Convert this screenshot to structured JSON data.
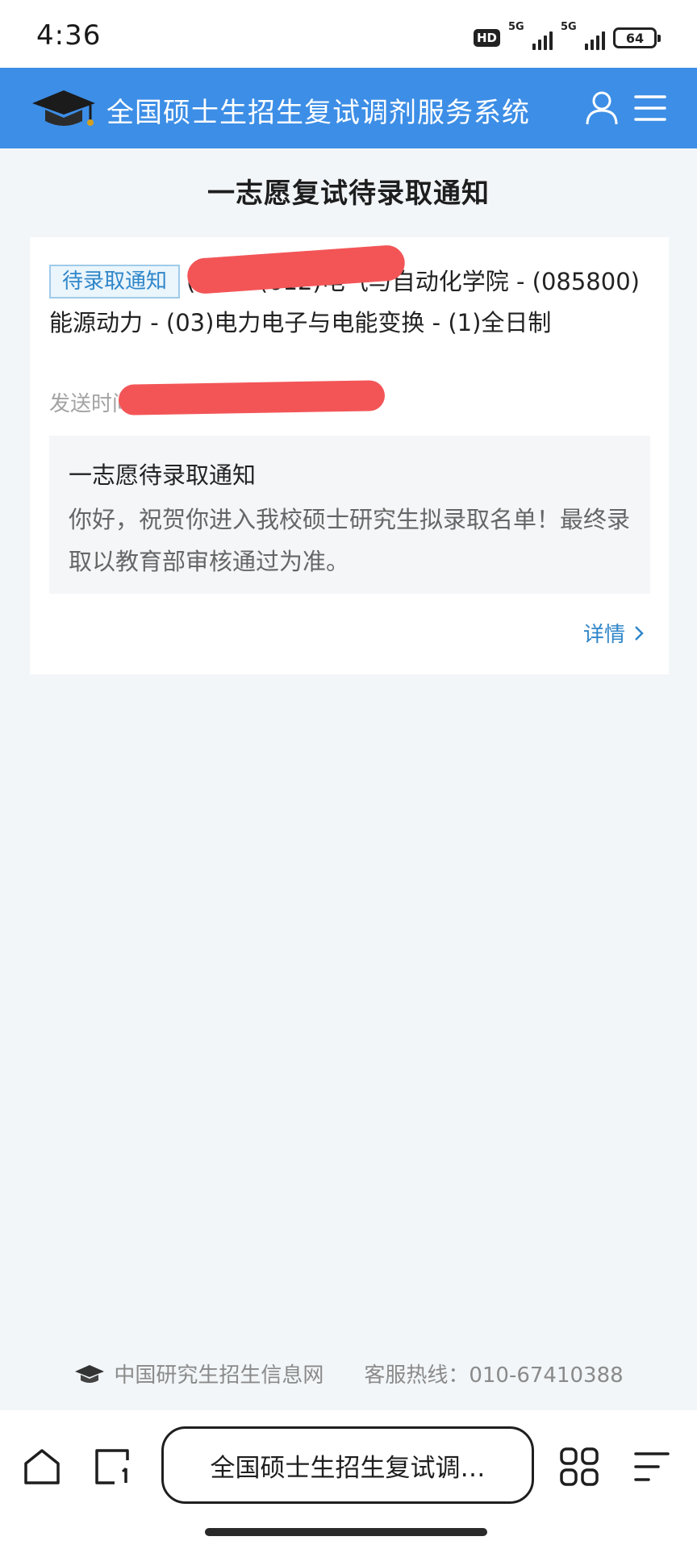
{
  "status_bar": {
    "time": "4:36",
    "hd_badge": "HD",
    "network_1": "5G",
    "network_2": "5G",
    "battery": "64"
  },
  "header": {
    "title": "全国硕士生招生复试调剂服务系统",
    "logo_icon": "graduation-cap-icon",
    "user_icon": "user-icon",
    "menu_icon": "menu-icon",
    "color": "#3d8ee6"
  },
  "page": {
    "title": "一志愿复试待录取通知"
  },
  "notice": {
    "tag": "待录取通知",
    "line1_visible": "(               )学 - (612)电气与自动化学院 - (085800)能源动力 - (03)电力电子与电能变换 - (1)全日制",
    "send_time_label": "发送时间",
    "message_title": "一志愿待录取通知",
    "message_body": "你好，祝贺你进入我校硕士研究生拟录取名单！最终录取以教育部审核通过为准。",
    "detail_link": "详情",
    "tag_color": "#2f86c9",
    "redaction_color": "#f35557"
  },
  "footer": {
    "site": "中国研究生招生信息网",
    "hotline": "客服热线：010-67410388"
  },
  "browser": {
    "address_text": "全国硕士生招生复试调…",
    "home_icon": "home-icon",
    "tabs_icon": "tabs-icon",
    "apps_icon": "apps-grid-icon",
    "more_icon": "more-menu-icon"
  }
}
